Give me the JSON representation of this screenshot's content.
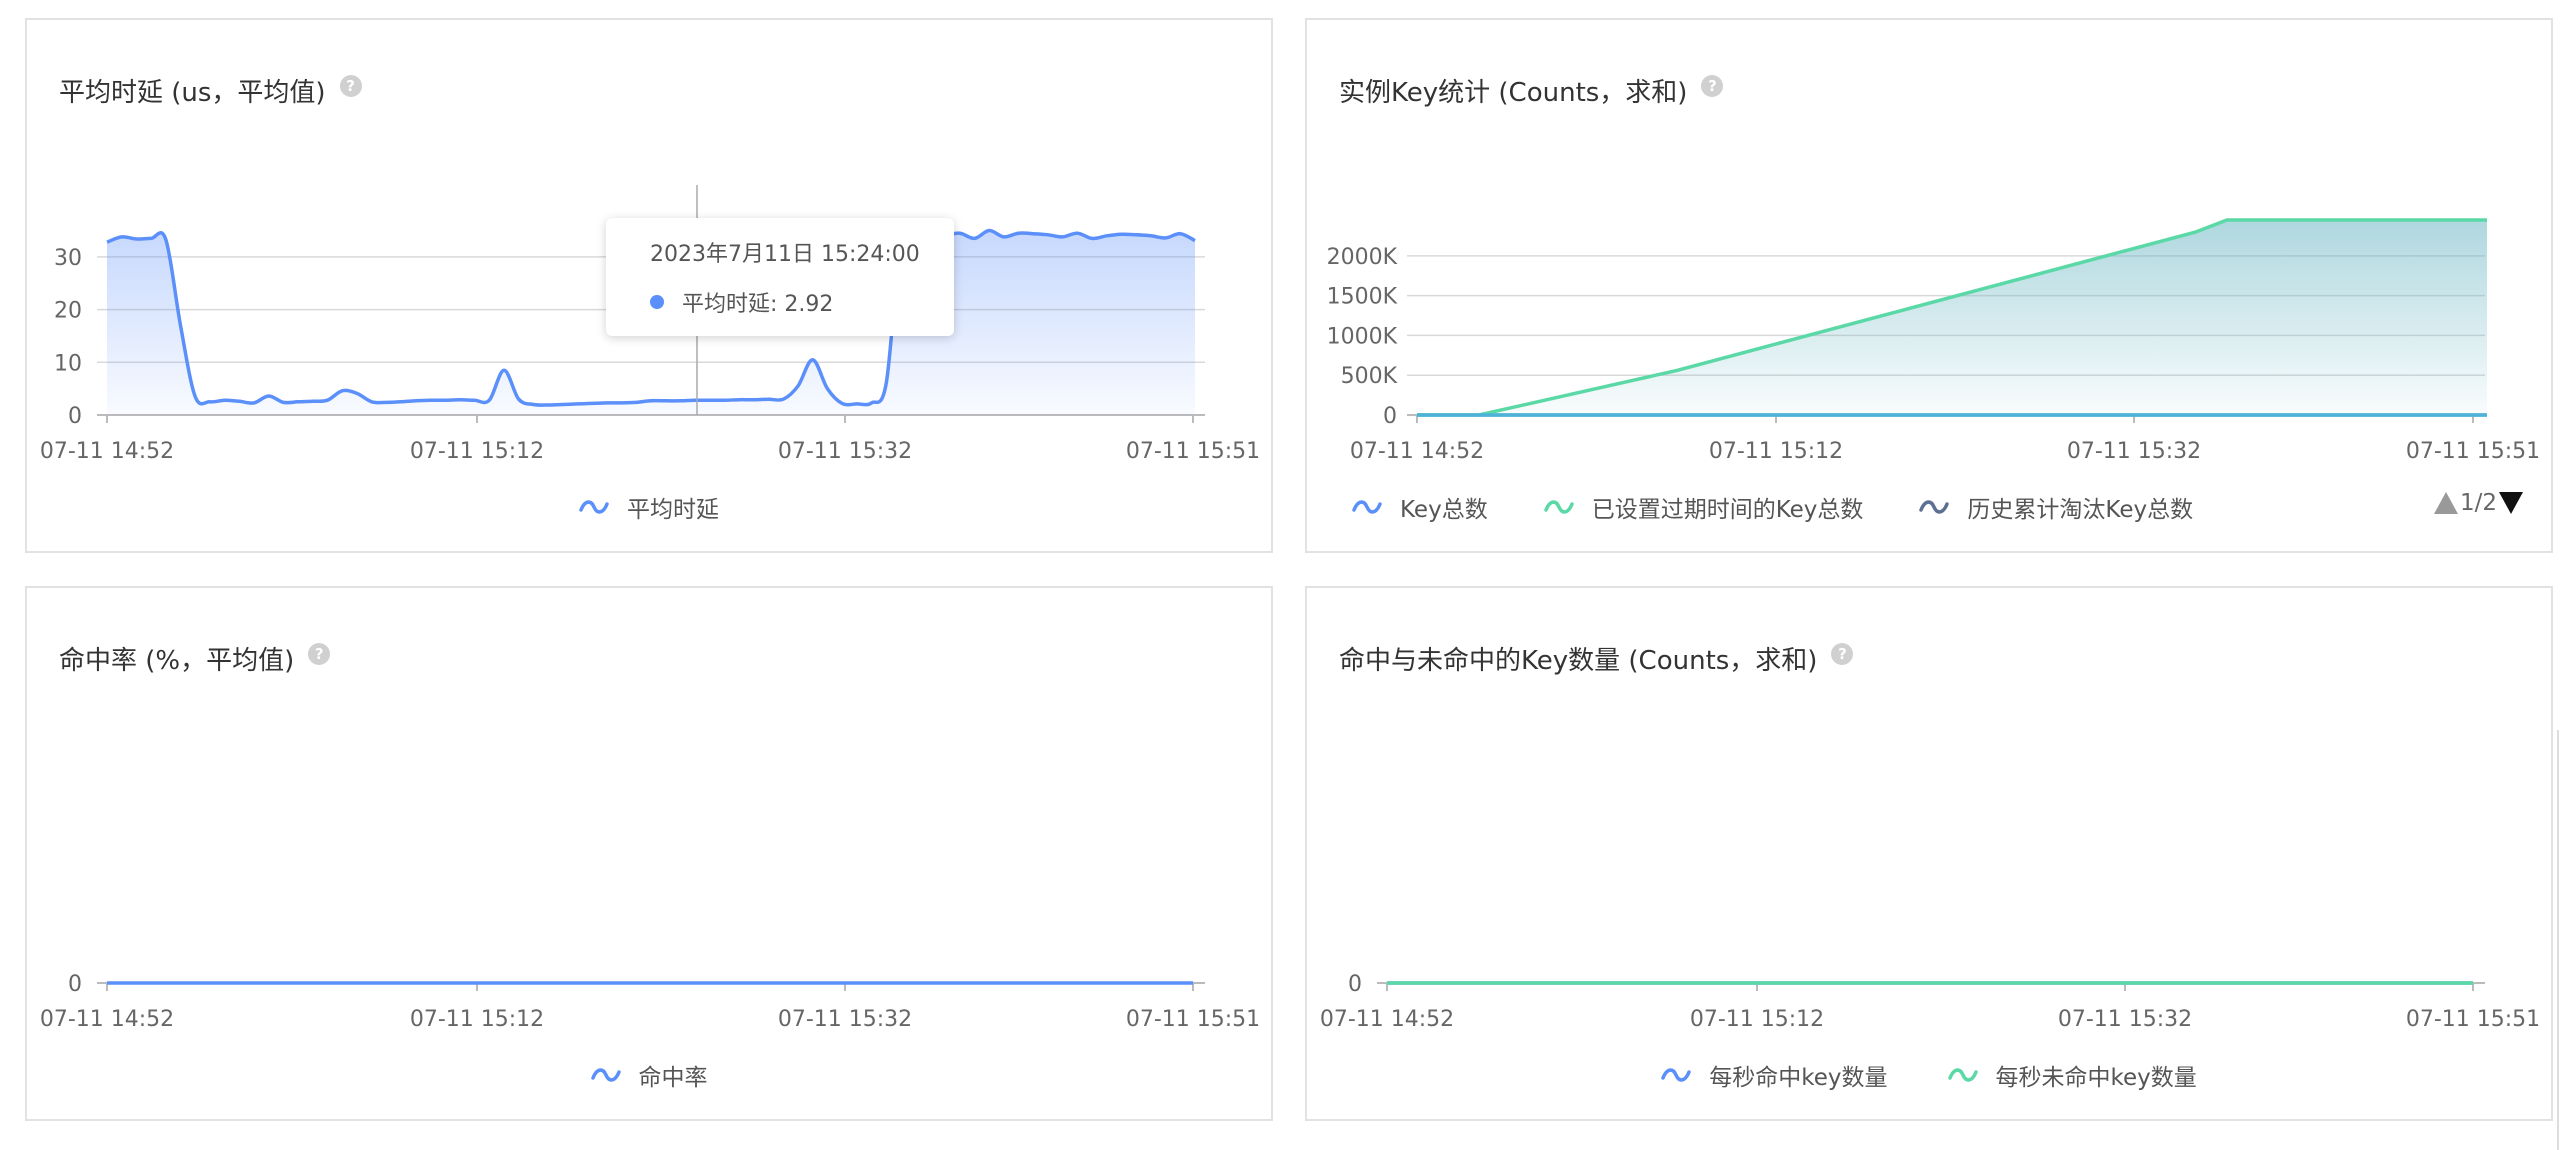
{
  "panels": [
    {
      "title": "平均时延 (us，平均值)",
      "legend": [
        {
          "label": "平均时延",
          "color": "#5b8ff9"
        }
      ],
      "tooltip": {
        "time": "2023年7月11日 15:24:00",
        "series": "平均时延",
        "value": "2.92",
        "label": "平均时延: 2.92"
      }
    },
    {
      "title": "实例Key统计 (Counts，求和)",
      "legend": [
        {
          "label": "Key总数",
          "color": "#5b8ff9"
        },
        {
          "label": "已设置过期时间的Key总数",
          "color": "#5ad8a6"
        },
        {
          "label": "历史累计淘汰Key总数",
          "color": "#5d7092"
        }
      ],
      "pager": "1/2"
    },
    {
      "title": "命中率 (%，平均值)",
      "legend": [
        {
          "label": "命中率",
          "color": "#5b8ff9"
        }
      ]
    },
    {
      "title": "命中与未命中的Key数量 (Counts，求和)",
      "legend": [
        {
          "label": "每秒命中key数量",
          "color": "#5b8ff9"
        },
        {
          "label": "每秒未命中key数量",
          "color": "#5ad8a6"
        }
      ]
    }
  ],
  "help_icon": "question-icon",
  "chart_data": [
    {
      "type": "area",
      "title": "平均时延 (us，平均值)",
      "x_ticks": [
        "07-11 14:52",
        "07-11 15:12",
        "07-11 15:32",
        "07-11 15:51"
      ],
      "y_ticks": [
        "0",
        "10",
        "20",
        "30"
      ],
      "ylim": [
        0,
        37
      ],
      "grid": true,
      "legend_position": "bottom",
      "series": [
        {
          "name": "平均时延",
          "color": "#5b8ff9",
          "values": [
            32.8,
            33.8,
            33.4,
            33.5,
            33.3,
            17,
            3.5,
            2.5,
            2.8,
            2.6,
            2.3,
            3.6,
            2.4,
            2.5,
            2.6,
            2.8,
            4.6,
            4.1,
            2.5,
            2.4,
            2.5,
            2.7,
            2.8,
            2.8,
            2.9,
            2.8,
            2.8,
            8.5,
            3.0,
            2.0,
            1.9,
            2.0,
            2.1,
            2.2,
            2.3,
            2.3,
            2.4,
            2.7,
            2.7,
            2.7,
            2.8,
            2.8,
            2.8,
            2.9,
            2.9,
            3.0,
            3.0,
            5.5,
            10.5,
            5.0,
            2.2,
            2.1,
            2.3,
            6.0,
            33.0,
            34.0,
            33.5,
            34.0,
            34.5,
            33.5,
            35.0,
            33.8,
            34.5,
            34.4,
            34.2,
            33.8,
            34.5,
            33.5,
            34.0,
            34.3,
            34.2,
            34.0,
            33.6,
            34.4,
            33.1
          ]
        }
      ]
    },
    {
      "type": "area",
      "title": "实例Key统计 (Counts，求和)",
      "x_ticks": [
        "07-11 14:52",
        "07-11 15:12",
        "07-11 15:32",
        "07-11 15:51"
      ],
      "y_ticks": [
        "0",
        "500K",
        "1000K",
        "1500K",
        "2000K"
      ],
      "ylim": [
        0,
        2450
      ],
      "grid": true,
      "legend_position": "bottom",
      "series": [
        {
          "name": "Key总数",
          "color": "#5b8ff9",
          "values": [
            0,
            0,
            0,
            0,
            0,
            0,
            0,
            0
          ]
        },
        {
          "name": "已设置过期时间的Key总数",
          "color": "#5ad8a6",
          "values": [
            0,
            0,
            0,
            2450,
            2450,
            2450
          ]
        },
        {
          "name": "历史累计淘汰Key总数",
          "color": "#5d7092",
          "values": [
            0,
            0,
            0,
            0,
            0,
            0,
            0,
            0
          ]
        }
      ]
    },
    {
      "type": "line",
      "title": "命中率 (%，平均值)",
      "x_ticks": [
        "07-11 14:52",
        "07-11 15:12",
        "07-11 15:32",
        "07-11 15:51"
      ],
      "y_ticks": [
        "0"
      ],
      "legend_position": "bottom",
      "series": [
        {
          "name": "命中率",
          "color": "#5b8ff9",
          "values": [
            0,
            0,
            0,
            0,
            0,
            0,
            0,
            0
          ]
        }
      ]
    },
    {
      "type": "line",
      "title": "命中与未命中的Key数量 (Counts，求和)",
      "x_ticks": [
        "07-11 14:52",
        "07-11 15:12",
        "07-11 15:32",
        "07-11 15:51"
      ],
      "y_ticks": [
        "0"
      ],
      "legend_position": "bottom",
      "series": [
        {
          "name": "每秒命中key数量",
          "color": "#5b8ff9",
          "values": [
            0,
            0,
            0,
            0,
            0,
            0,
            0,
            0
          ]
        },
        {
          "name": "每秒未命中key数量",
          "color": "#5ad8a6",
          "values": [
            0,
            0,
            0,
            0,
            0,
            0,
            0,
            0
          ]
        }
      ]
    }
  ]
}
